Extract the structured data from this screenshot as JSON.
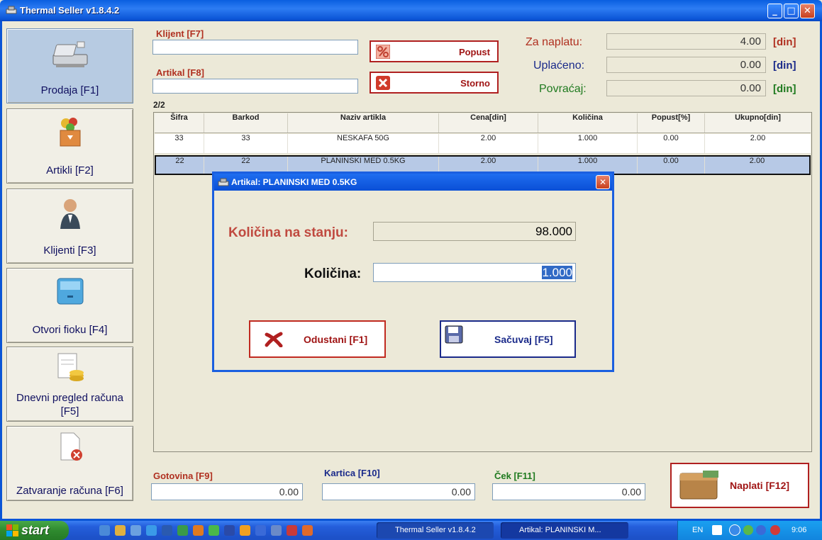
{
  "window": {
    "title": "Thermal Seller v1.8.4.2"
  },
  "sidebar": {
    "items": [
      {
        "label": "Prodaja [F1]"
      },
      {
        "label": "Artikli [F2]"
      },
      {
        "label": "Klijenti [F3]"
      },
      {
        "label": "Otvori fioku [F4]"
      },
      {
        "label": "Dnevni pregled računa [F5]"
      },
      {
        "label": "Zatvaranje računa [F6]"
      }
    ]
  },
  "header": {
    "client_label": "Klijent [F7]",
    "client_value": "",
    "article_label": "Artikal [F8]",
    "article_value": "",
    "discount_button": "Popust",
    "storno_button": "Storno",
    "za_naplatu_label": "Za naplatu:",
    "za_naplatu_value": "4.00",
    "uplaceno_label": "Uplaćeno:",
    "uplaceno_value": "0.00",
    "povracaj_label": "Povraćaj:",
    "povracaj_value": "0.00",
    "currency": "[din]"
  },
  "grid": {
    "counter": "2/2",
    "columns": [
      "Šifra",
      "Barkod",
      "Naziv artikla",
      "Cena[din]",
      "Količina",
      "Popust[%]",
      "Ukupno[din]"
    ],
    "rows": [
      [
        "33",
        "33",
        "NESKAFA 50G",
        "2.00",
        "1.000",
        "0.00",
        "2.00"
      ],
      [
        "22",
        "22",
        "PLANINSKI MED 0.5KG",
        "2.00",
        "1.000",
        "0.00",
        "2.00"
      ]
    ]
  },
  "payment": {
    "cash_label": "Gotovina [F9]",
    "cash_value": "0.00",
    "card_label": "Kartica [F10]",
    "card_value": "0.00",
    "check_label": "Ček [F11]",
    "check_value": "0.00",
    "pay_button": "Naplati [F12]"
  },
  "dialog": {
    "title": "Artikal: PLANINSKI MED 0.5KG",
    "stock_label": "Količina na stanju:",
    "stock_value": "98.000",
    "qty_label": "Količina:",
    "qty_value": "1.000",
    "cancel_button": "Odustani [F1]",
    "save_button": "Sačuvaj [F5]"
  },
  "taskbar": {
    "start_label": "start",
    "tasks": [
      {
        "label": "Thermal Seller v1.8.4.2"
      },
      {
        "label": "Artikal: PLANINSKI M..."
      }
    ],
    "language": "EN",
    "clock": "9:06"
  },
  "colors": {
    "accent_red": "#b03020",
    "uplaceno_blue": "#1a2a8a",
    "povracaj_green": "#1f7a1f",
    "selected_row": "#b7c9e6",
    "titlebar_blue": "#0a5fe0"
  }
}
